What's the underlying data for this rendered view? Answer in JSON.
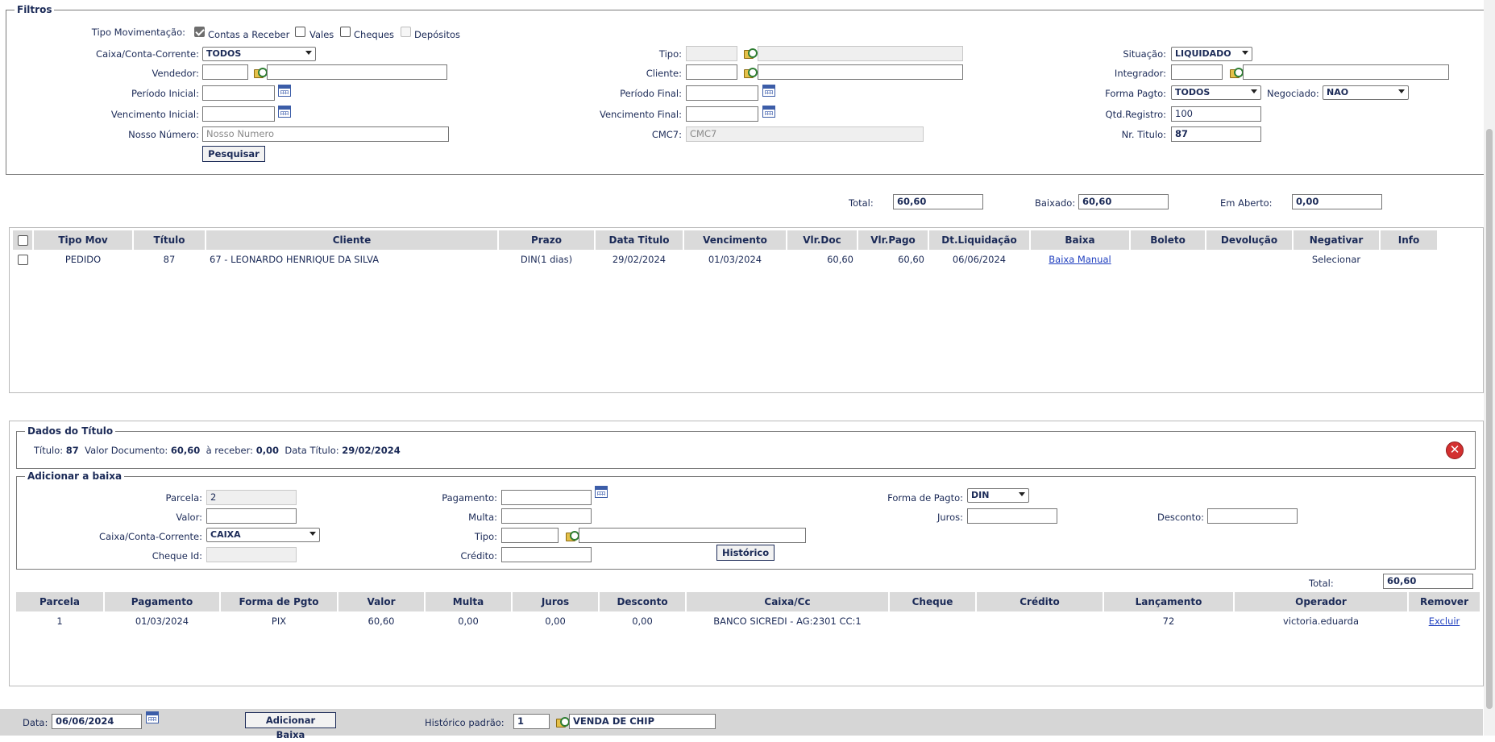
{
  "filtros": {
    "legend": "Filtros",
    "tipo_movimentacao": {
      "label": "Tipo Movimentação:",
      "options": [
        {
          "label": "Contas a Receber",
          "checked": true
        },
        {
          "label": "Vales",
          "checked": false
        },
        {
          "label": "Cheques",
          "checked": false
        },
        {
          "label": "Depósitos",
          "checked": false,
          "disabled": true
        }
      ]
    },
    "caixa_conta_corrente": {
      "label": "Caixa/Conta-Corrente:",
      "value": "TODOS"
    },
    "tipo": {
      "label": "Tipo:",
      "code": "",
      "desc": ""
    },
    "situacao": {
      "label": "Situação:",
      "value": "LIQUIDADO"
    },
    "vendedor": {
      "label": "Vendedor:",
      "code": "",
      "desc": ""
    },
    "cliente": {
      "label": "Cliente:",
      "code": "",
      "desc": ""
    },
    "integrador": {
      "label": "Integrador:",
      "code": "",
      "desc": ""
    },
    "periodo_inicial": {
      "label": "Período Inicial:",
      "value": ""
    },
    "periodo_final": {
      "label": "Período Final:",
      "value": ""
    },
    "forma_pagto": {
      "label": "Forma Pagto:",
      "value": "TODOS"
    },
    "negociado": {
      "label": "Negociado:",
      "value": "NAO"
    },
    "vencimento_inicial": {
      "label": "Vencimento Inicial:",
      "value": ""
    },
    "vencimento_final": {
      "label": "Vencimento Final:",
      "value": ""
    },
    "qtd_registro": {
      "label": "Qtd.Registro:",
      "value": "100"
    },
    "nosso_numero": {
      "label": "Nosso Número:",
      "placeholder": "Nosso Numero"
    },
    "cmc7": {
      "label": "CMC7:",
      "placeholder": "CMC7"
    },
    "nr_titulo": {
      "label": "Nr. Titulo:",
      "value": "87"
    },
    "pesquisar_label": "Pesquisar"
  },
  "totals": {
    "total_label": "Total:",
    "total_value": "60,60",
    "baixado_label": "Baixado:",
    "baixado_value": "60,60",
    "em_aberto_label": "Em Aberto:",
    "em_aberto_value": "0,00"
  },
  "titles_table": {
    "columns": [
      "Tipo Mov",
      "Título",
      "Cliente",
      "Prazo",
      "Data Titulo",
      "Vencimento",
      "Vlr.Doc",
      "Vlr.Pago",
      "Dt.Liquidação",
      "Baixa",
      "Boleto",
      "Devolução",
      "Negativar",
      "Info"
    ],
    "rows": [
      {
        "tipo_mov": "PEDIDO",
        "titulo": "87",
        "cliente": "67 - LEONARDO HENRIQUE DA SILVA",
        "prazo": "DIN(1 dias)",
        "data_titulo": "29/02/2024",
        "vencimento": "01/03/2024",
        "vlr_doc": "60,60",
        "vlr_pago": "60,60",
        "dt_liquidacao": "06/06/2024",
        "baixa": "Baixa Manual",
        "boleto": "",
        "devolucao": "",
        "negativar": "Selecionar",
        "info": ""
      }
    ]
  },
  "dados_titulo": {
    "legend": "Dados do Título",
    "titulo_label": "Título:",
    "titulo_value": "87",
    "valor_documento_label": "Valor Documento:",
    "valor_documento_value": "60,60",
    "a_receber_label": "à receber:",
    "a_receber_value": "0,00",
    "data_titulo_label": "Data Título:",
    "data_titulo_value": "29/02/2024"
  },
  "adicionar_baixa": {
    "legend": "Adicionar a baixa",
    "parcela": {
      "label": "Parcela:",
      "value": "2"
    },
    "pagamento": {
      "label": "Pagamento:",
      "value": ""
    },
    "forma_pagto": {
      "label": "Forma de Pagto:",
      "value": "DIN"
    },
    "valor": {
      "label": "Valor:",
      "value": ""
    },
    "multa": {
      "label": "Multa:",
      "value": ""
    },
    "juros": {
      "label": "Juros:",
      "value": ""
    },
    "desconto": {
      "label": "Desconto:",
      "value": ""
    },
    "caixa": {
      "label": "Caixa/Conta-Corrente:",
      "value": "CAIXA"
    },
    "tipo": {
      "label": "Tipo:",
      "code": "",
      "desc": ""
    },
    "cheque_id": {
      "label": "Cheque Id:",
      "value": ""
    },
    "credito": {
      "label": "Crédito:",
      "value": ""
    },
    "historico_label": "Histórico",
    "total_label": "Total:",
    "total_value": "60,60"
  },
  "baixas_table": {
    "columns": [
      "Parcela",
      "Pagamento",
      "Forma de Pgto",
      "Valor",
      "Multa",
      "Juros",
      "Desconto",
      "Caixa/Cc",
      "Cheque",
      "Crédito",
      "Lançamento",
      "Operador",
      "Remover"
    ],
    "rows": [
      {
        "parcela": "1",
        "pagamento": "01/03/2024",
        "forma": "PIX",
        "valor": "60,60",
        "multa": "0,00",
        "juros": "0,00",
        "desconto": "0,00",
        "caixa": "BANCO SICREDI - AG:2301 CC:1",
        "cheque": "",
        "credito": "",
        "lancamento": "72",
        "operador": "victoria.eduarda",
        "remover": "Excluir"
      }
    ]
  },
  "footer": {
    "data_label": "Data:",
    "data_value": "06/06/2024",
    "adicionar_label": "Adicionar Baixa",
    "historico_label": "Histórico padrão:",
    "historico_code": "1",
    "historico_desc": "VENDA DE CHIP"
  }
}
